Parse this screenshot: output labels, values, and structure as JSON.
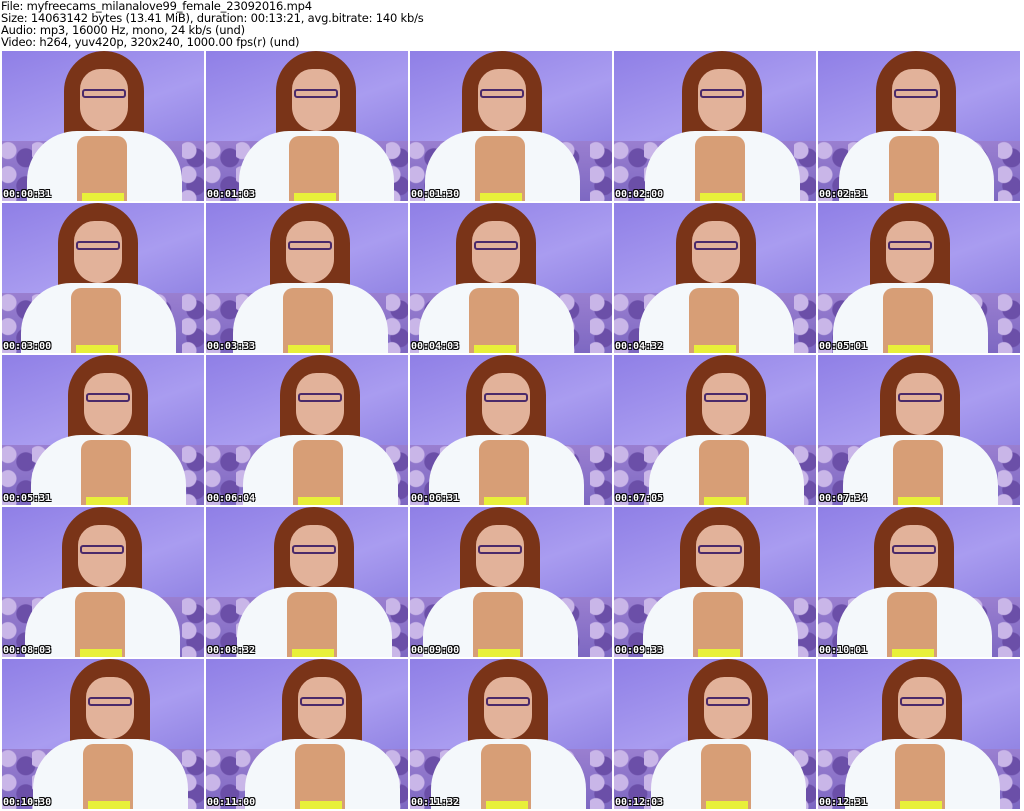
{
  "header": {
    "file": "File: myfreecams_milanalove99_female_23092016.mp4",
    "size": "Size: 14063142 bytes (13.41 MiB), duration: 00:13:21, avg.bitrate: 140 kb/s",
    "audio": "Audio: mp3, 16000 Hz, mono, 24 kb/s (und)",
    "video": "Video: h264, yuv420p, 320x240, 1000.00 fps(r) (und)"
  },
  "thumbnails": [
    "00:00:31",
    "00:01:03",
    "00:01:30",
    "00:02:00",
    "00:02:31",
    "00:03:00",
    "00:03:33",
    "00:04:03",
    "00:04:32",
    "00:05:01",
    "00:05:31",
    "00:06:04",
    "00:06:31",
    "00:07:05",
    "00:07:34",
    "00:08:03",
    "00:08:32",
    "00:09:00",
    "00:09:33",
    "00:10:01",
    "00:10:30",
    "00:11:00",
    "00:11:32",
    "00:12:03",
    "00:12:31"
  ]
}
